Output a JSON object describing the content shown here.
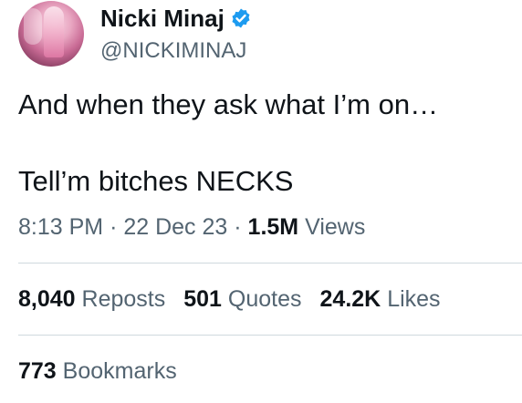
{
  "author": {
    "display_name": "Nicki Minaj",
    "handle": "@NICKIMINAJ",
    "verified_icon": "verified-badge-icon",
    "verified_color": "#1d9bf0"
  },
  "tweet": {
    "lines": [
      "And when they ask what I’m on…",
      "Tell’m bitches NECKS"
    ]
  },
  "meta": {
    "time": "8:13 PM",
    "separator": "·",
    "date": "22 Dec 23",
    "views_count": "1.5M",
    "views_label": "Views"
  },
  "stats": {
    "reposts_count": "8,040",
    "reposts_label": "Reposts",
    "quotes_count": "501",
    "quotes_label": "Quotes",
    "likes_count": "24.2K",
    "likes_label": "Likes"
  },
  "bookmarks": {
    "count": "773",
    "label": "Bookmarks"
  }
}
